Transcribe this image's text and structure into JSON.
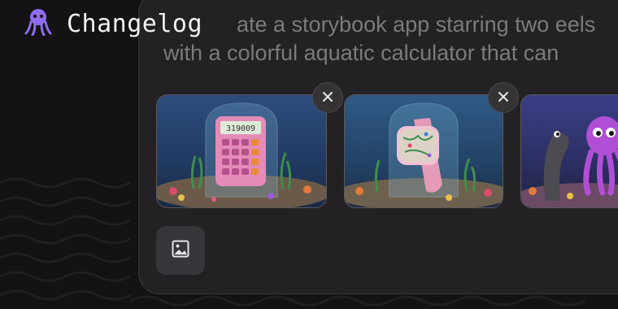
{
  "app": {
    "brand_icon": "octopus-logo-icon",
    "title": "Changelog"
  },
  "prompt": {
    "line1": "ate a storybook app starring two eels",
    "line2": "with a colorful aquatic calculator that can"
  },
  "thumbnails": [
    {
      "alt": "pink calculator in aquarium",
      "screen_value": "319009",
      "removable": true,
      "remove_icon": "close-icon"
    },
    {
      "alt": "pink smartwatch in aquarium",
      "removable": true,
      "remove_icon": "close-icon"
    },
    {
      "alt": "eel and purple octopus underwater",
      "removable": false
    }
  ],
  "toolbar": {
    "upload_icon": "image-icon"
  },
  "colors": {
    "background": "#141214",
    "panel": "#232123",
    "accent_purple": "#8f6cf0"
  }
}
